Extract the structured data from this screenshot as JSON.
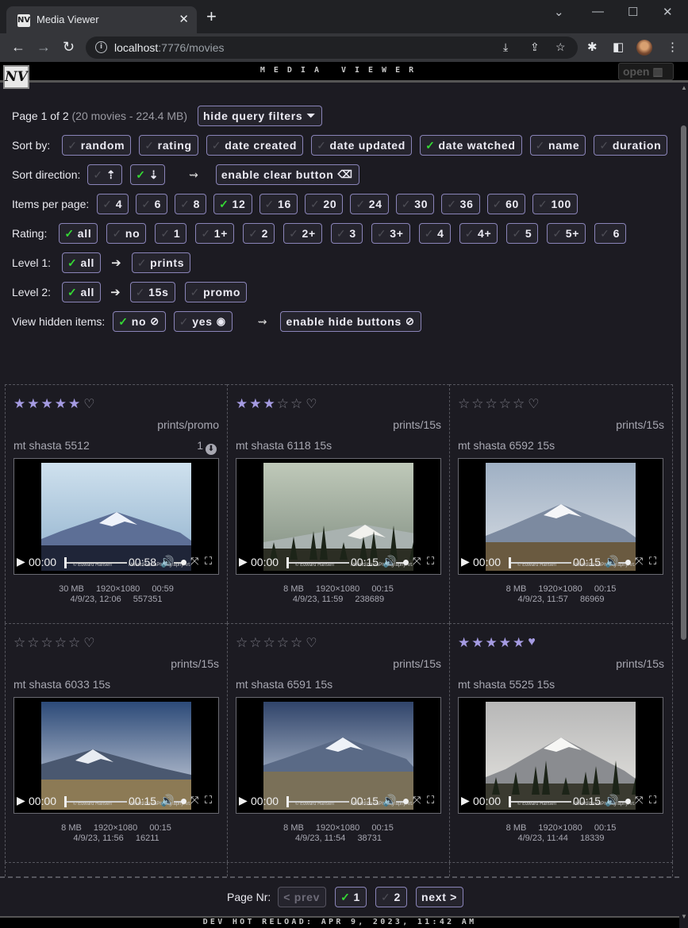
{
  "browser": {
    "tab_title": "Media Viewer",
    "url_host": "localhost",
    "url_rest": ":7776/movies"
  },
  "app": {
    "logo_text": "NV",
    "title": "MEDIA VIEWER",
    "open_label": "open"
  },
  "filters": {
    "page_info": "Page 1 of 2",
    "page_detail": "(20 movies - 224.4 MB)",
    "hide_filters_label": "hide query filters",
    "sort_by_label": "Sort by:",
    "sort_by": [
      {
        "label": "random",
        "on": false
      },
      {
        "label": "rating",
        "on": false
      },
      {
        "label": "date created",
        "on": false
      },
      {
        "label": "date updated",
        "on": false
      },
      {
        "label": "date watched",
        "on": true
      },
      {
        "label": "name",
        "on": false
      },
      {
        "label": "duration",
        "on": false
      }
    ],
    "sort_dir_label": "Sort direction:",
    "clear_button_label": "enable clear button",
    "per_page_label": "Items per page:",
    "per_page": [
      {
        "label": "4",
        "on": false
      },
      {
        "label": "6",
        "on": false
      },
      {
        "label": "8",
        "on": false
      },
      {
        "label": "12",
        "on": true
      },
      {
        "label": "16",
        "on": false
      },
      {
        "label": "20",
        "on": false
      },
      {
        "label": "24",
        "on": false
      },
      {
        "label": "30",
        "on": false
      },
      {
        "label": "36",
        "on": false
      },
      {
        "label": "60",
        "on": false
      },
      {
        "label": "100",
        "on": false
      }
    ],
    "rating_label": "Rating:",
    "ratings": [
      {
        "label": "all",
        "on": true
      },
      {
        "label": "no",
        "on": false
      },
      {
        "label": "1",
        "on": false
      },
      {
        "label": "1+",
        "on": false
      },
      {
        "label": "2",
        "on": false
      },
      {
        "label": "2+",
        "on": false
      },
      {
        "label": "3",
        "on": false
      },
      {
        "label": "3+",
        "on": false
      },
      {
        "label": "4",
        "on": false
      },
      {
        "label": "4+",
        "on": false
      },
      {
        "label": "5",
        "on": false
      },
      {
        "label": "5+",
        "on": false
      },
      {
        "label": "6",
        "on": false
      }
    ],
    "level1_label": "Level 1:",
    "level1": [
      {
        "label": "all",
        "on": true
      },
      {
        "label": "prints",
        "on": false
      }
    ],
    "level2_label": "Level 2:",
    "level2": [
      {
        "label": "all",
        "on": true
      },
      {
        "label": "15s",
        "on": false
      },
      {
        "label": "promo",
        "on": false
      }
    ],
    "hidden_label": "View hidden items:",
    "hidden_no": "no",
    "hidden_yes": "yes",
    "hide_buttons_label": "enable hide buttons"
  },
  "cards": [
    {
      "rating": 5,
      "fav": false,
      "tag": "prints/promo",
      "title": "mt shasta 5512",
      "count": "1",
      "time": "00:00",
      "duration": "00:58",
      "size": "30 MB",
      "res": "1920×1080",
      "dur_meta": "00:59",
      "date": "4/9/23, 12:06",
      "id": "557351"
    },
    {
      "rating": 3,
      "fav": false,
      "tag": "prints/15s",
      "title": "mt shasta 6118 15s",
      "count": "",
      "time": "00:00",
      "duration": "00:15",
      "size": "8 MB",
      "res": "1920×1080",
      "dur_meta": "00:15",
      "date": "4/9/23, 11:59",
      "id": "238689"
    },
    {
      "rating": 0,
      "fav": false,
      "tag": "prints/15s",
      "title": "mt shasta 6592 15s",
      "count": "",
      "time": "00:00",
      "duration": "00:15",
      "size": "8 MB",
      "res": "1920×1080",
      "dur_meta": "00:15",
      "date": "4/9/23, 11:57",
      "id": "86969"
    },
    {
      "rating": 0,
      "fav": false,
      "tag": "prints/15s",
      "title": "mt shasta 6033 15s",
      "count": "",
      "time": "00:00",
      "duration": "00:15",
      "size": "8 MB",
      "res": "1920×1080",
      "dur_meta": "00:15",
      "date": "4/9/23, 11:56",
      "id": "16211"
    },
    {
      "rating": 0,
      "fav": false,
      "tag": "prints/15s",
      "title": "mt shasta 6591 15s",
      "count": "",
      "time": "00:00",
      "duration": "00:15",
      "size": "8 MB",
      "res": "1920×1080",
      "dur_meta": "00:15",
      "date": "4/9/23, 11:54",
      "id": "38731"
    },
    {
      "rating": 5,
      "fav": true,
      "tag": "prints/15s",
      "title": "mt shasta 5525 15s",
      "count": "",
      "time": "00:00",
      "duration": "00:15",
      "size": "8 MB",
      "res": "1920×1080",
      "dur_meta": "00:15",
      "date": "4/9/23, 11:44",
      "id": "18339"
    }
  ],
  "watermark_left": "© Edward Hansen",
  "watermark_right": "MountShastaPhotographyArt.com",
  "pager": {
    "label": "Page Nr:",
    "prev": "< prev",
    "pages": [
      {
        "label": "1",
        "on": true
      },
      {
        "label": "2",
        "on": false
      }
    ],
    "next": "next >"
  },
  "status": "DEV HOT RELOAD: APR 9, 2023, 11:42 AM",
  "icons": {
    "filter": "funnel-icon",
    "eraser": "eraser-icon",
    "eye_off": "eye-slash-icon",
    "eye": "eye-icon",
    "map": "map-icon"
  }
}
